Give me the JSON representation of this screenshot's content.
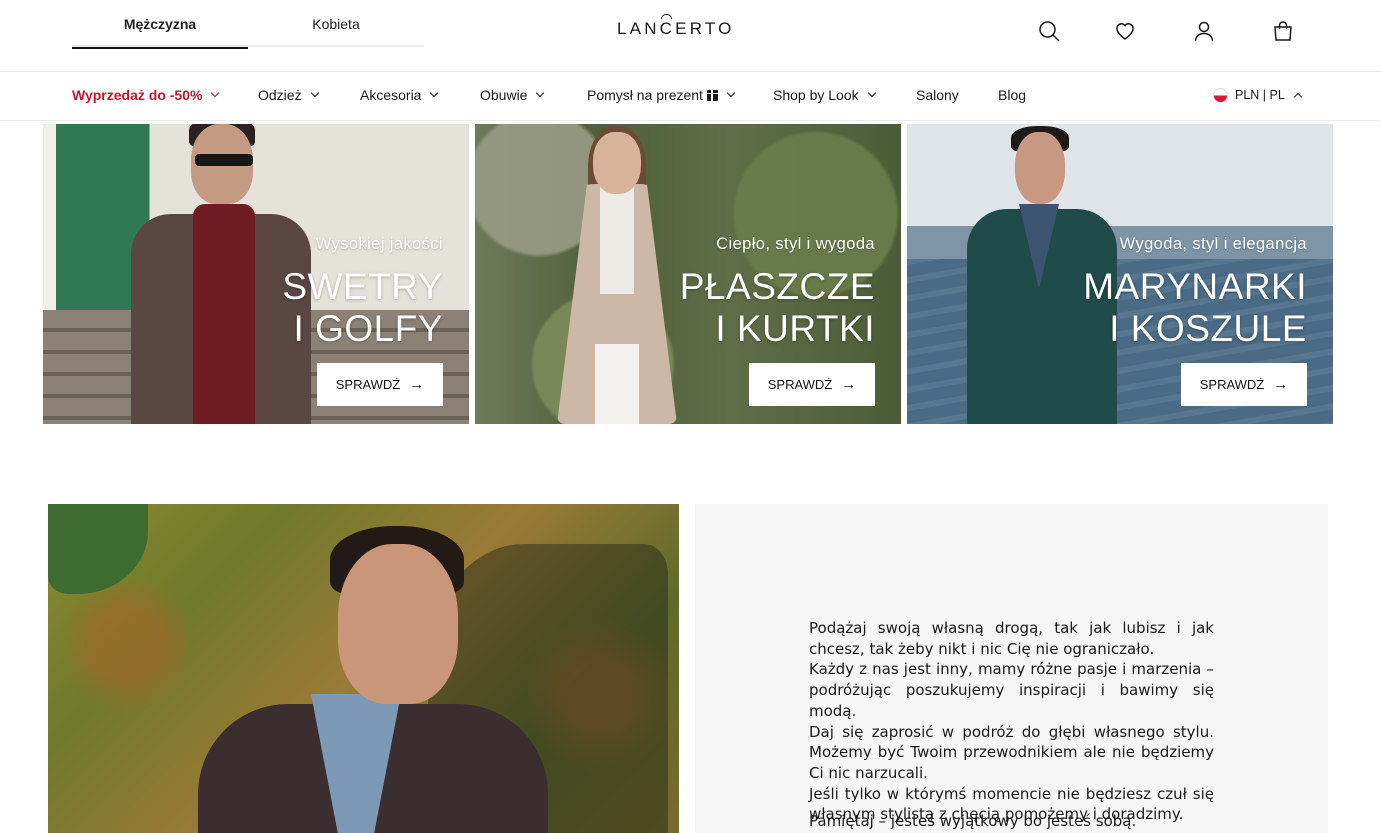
{
  "header": {
    "gender_tabs": [
      {
        "label": "Mężczyzna",
        "active": true
      },
      {
        "label": "Kobieta",
        "active": false
      }
    ],
    "logo_text": "LANCERTO",
    "icons": [
      "search-icon",
      "heart-icon",
      "user-icon",
      "cart-icon"
    ]
  },
  "nav": {
    "items": [
      {
        "label": "Wyprzedaż do -50%",
        "has_dropdown": true,
        "highlight": true
      },
      {
        "label": "Odzież",
        "has_dropdown": true
      },
      {
        "label": "Akcesoria",
        "has_dropdown": true
      },
      {
        "label": "Obuwie",
        "has_dropdown": true
      },
      {
        "label": "Pomysł na prezent",
        "has_dropdown": true,
        "icon": "gift-icon"
      },
      {
        "label": "Shop by Look",
        "has_dropdown": true
      },
      {
        "label": "Salony",
        "has_dropdown": false
      },
      {
        "label": "Blog",
        "has_dropdown": false
      }
    ],
    "locale": "PLN | PL",
    "sale_color": "#c0172d"
  },
  "banners": [
    {
      "tagline": "Wysokiej jakości",
      "line1": "SWETRY",
      "line2": "I GOLFY",
      "cta": "SPRAWDŹ"
    },
    {
      "tagline": "Ciepło, styl i wygoda",
      "line1": "PŁASZCZE",
      "line2": "I KURTKI",
      "cta": "SPRAWDŹ"
    },
    {
      "tagline": "Wygoda, styl i elegancja",
      "line1": "MARYNARKI",
      "line2": "I KOSZULE",
      "cta": "SPRAWDŹ"
    }
  ],
  "story": {
    "paragraphs": [
      "Podążaj swoją własną drogą, tak jak lubisz i jak chcesz, tak żeby nikt i nic Cię nie ograniczało.",
      "Każdy z nas jest inny, mamy różne pasje i marzenia – podróżując poszukujemy inspiracji i bawimy się modą.",
      "Daj się zaprosić w podróż do głębi własnego stylu. Możemy być Twoim przewodnikiem ale nie będziemy Ci nic narzucali.",
      "Jeśli tylko w którymś momencie nie będziesz czuł się własnym stylistą z chęcią pomożemy i doradzimy."
    ],
    "closing": "Pamiętaj – jesteś wyjątkowy bo jesteś sobą."
  }
}
